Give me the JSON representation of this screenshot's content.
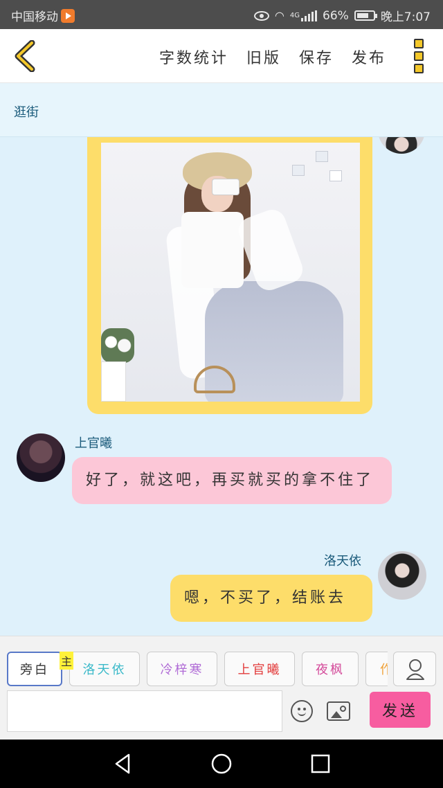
{
  "status_bar": {
    "carrier": "中国移动",
    "network": "4G",
    "battery": "66%",
    "time": "晚上7:07"
  },
  "toolbar": {
    "word_count": "字数统计",
    "old_version": "旧版",
    "save": "保存",
    "publish": "发布"
  },
  "scene": {
    "tag": "逛街"
  },
  "chat": {
    "messages": [
      {
        "sender": "上官曦",
        "text": "好了，就这吧，再买就买的拿不住了"
      },
      {
        "sender": "洛天依",
        "text": "嗯，不买了，结账去"
      }
    ]
  },
  "input_area": {
    "roles": [
      {
        "label": "旁白",
        "color": "#333333"
      },
      {
        "label": "洛天依",
        "color": "#3bb9c9"
      },
      {
        "label": "冷梓寒",
        "color": "#b06bd6"
      },
      {
        "label": "上官曦",
        "color": "#e23b3b"
      },
      {
        "label": "夜枫",
        "color": "#d44a9a"
      },
      {
        "label": "作",
        "color": "#f0a23a"
      }
    ],
    "main_badge": "主",
    "message_value": "",
    "send_label": "发送"
  },
  "colors": {
    "chat_background": "#dff1fb",
    "bubble_pink": "#fcc7d7",
    "bubble_yellow": "#fddd6a",
    "send_button": "#f75da0",
    "name_color": "#1a5a7a"
  }
}
